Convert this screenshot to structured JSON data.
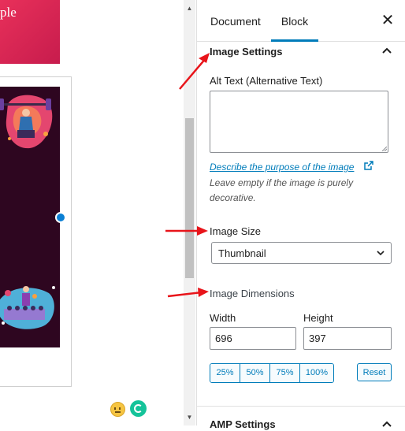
{
  "canvas": {
    "hero_text": "ple"
  },
  "sidebar": {
    "tabs": [
      {
        "label": "Document"
      },
      {
        "label": "Block"
      }
    ],
    "close_icon": "close-icon",
    "image_settings": {
      "title": "Image Settings",
      "alt_text_label": "Alt Text (Alternative Text)",
      "alt_text_value": "",
      "describe_link": "Describe the purpose of the image",
      "help_text": "Leave empty if the image is purely decorative.",
      "image_size_label": "Image Size",
      "image_size_value": "Thumbnail",
      "image_dimensions_label": "Image Dimensions",
      "width_label": "Width",
      "height_label": "Height",
      "width_value": "696",
      "height_value": "397",
      "percent_buttons": [
        "25%",
        "50%",
        "75%",
        "100%"
      ],
      "reset_label": "Reset"
    },
    "amp_settings_title": "AMP Settings"
  },
  "colors": {
    "accent": "#007cba",
    "annotation_arrow": "#e8141a",
    "hero": "#d72052",
    "image_bg": "#2e0620"
  }
}
